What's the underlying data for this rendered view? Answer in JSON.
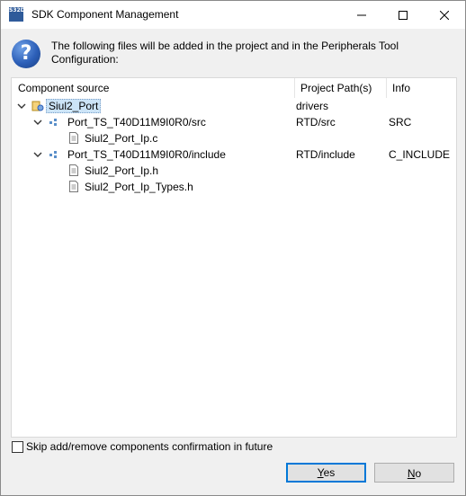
{
  "window": {
    "title": "SDK Component Management",
    "app_icon": "S32DS",
    "controls": [
      "minimize-icon",
      "maximize-icon",
      "close-icon"
    ]
  },
  "message": {
    "icon": "question-icon",
    "text": "The following files will be added in the project and in the Peripherals Tool Configuration:"
  },
  "table": {
    "headers": [
      "Component source",
      "Project Path(s)",
      "Info"
    ],
    "rows": [
      {
        "label": "Siul2_Port",
        "path": "drivers",
        "info": "",
        "icon": "component-icon",
        "expanded": true,
        "selected": true
      },
      {
        "label": "Port_TS_T40D11M9I0R0/src",
        "path": "RTD/src",
        "info": "SRC",
        "icon": "package-icon",
        "expanded": true
      },
      {
        "label": "Siul2_Port_Ip.c",
        "path": "",
        "info": "",
        "icon": "file-icon"
      },
      {
        "label": "Port_TS_T40D11M9I0R0/include",
        "path": "RTD/include",
        "info": "C_INCLUDE",
        "icon": "package-icon",
        "expanded": true
      },
      {
        "label": "Siul2_Port_Ip.h",
        "path": "",
        "info": "",
        "icon": "file-icon"
      },
      {
        "label": "Siul2_Port_Ip_Types.h",
        "path": "",
        "info": "",
        "icon": "file-icon"
      }
    ]
  },
  "skip_checkbox": {
    "label": "Skip add/remove components confirmation in future",
    "checked": false
  },
  "buttons": {
    "yes_mnemonic": "Y",
    "yes_rest": "es",
    "no_mnemonic": "N",
    "no_rest": "o"
  }
}
